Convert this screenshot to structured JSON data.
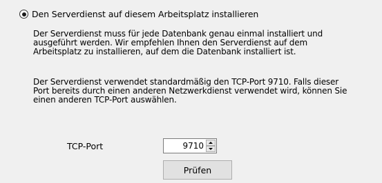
{
  "option": {
    "label": "Den Serverdienst auf diesem Arbeitsplatz installieren",
    "selected": true
  },
  "description": {
    "paragraph1": [
      "Der Serverdienst muss für jede Datenbank genau einmal installiert und",
      "ausgeführt werden. Wir empfehlen Ihnen den Serverdienst auf dem",
      "Arbeitsplatz zu installieren, auf dem die Datenbank installiert ist."
    ],
    "paragraph2": [
      "Der Serverdienst verwendet standardmäßig den TCP-Port 9710. Falls dieser",
      "Port bereits durch einen anderen Netzwerkdienst verwendet wird, können Sie",
      "einen anderen TCP-Port auswählen."
    ]
  },
  "port": {
    "label": "TCP-Port",
    "value": "9710"
  },
  "check_button": {
    "label": "Prüfen"
  },
  "icons": {
    "spin_up": "chevron-up-icon",
    "spin_down": "chevron-down-icon"
  }
}
